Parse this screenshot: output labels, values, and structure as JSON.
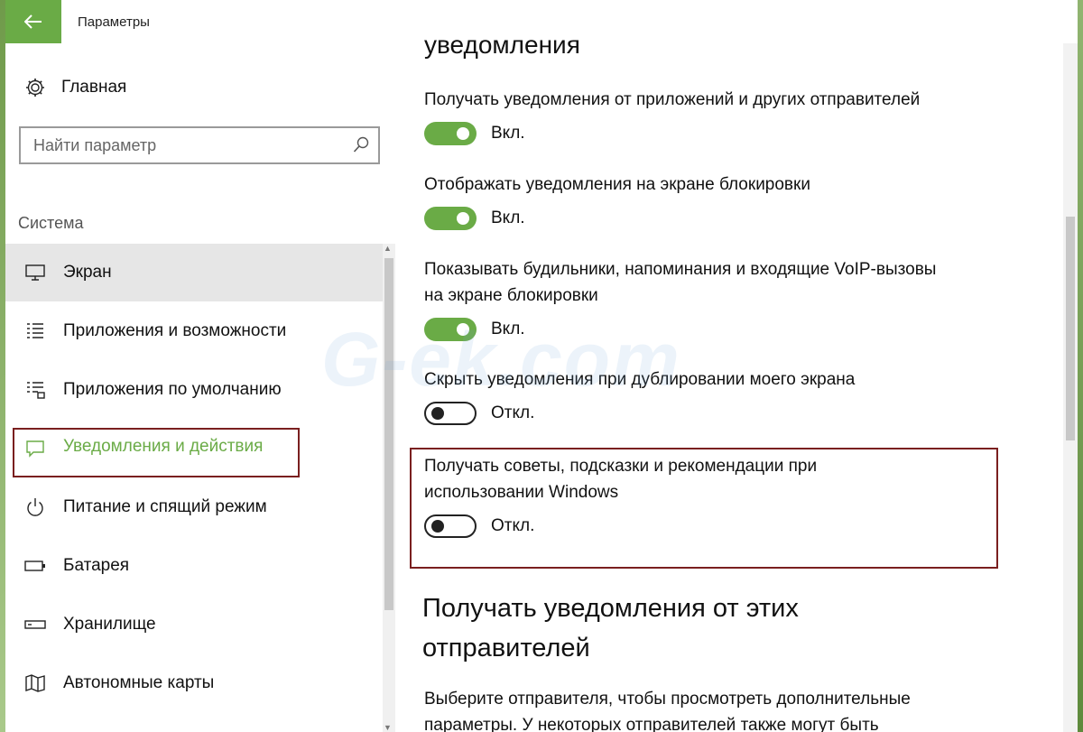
{
  "window": {
    "title": "Параметры",
    "accent": "#6aab46",
    "highlight": "#7a1f1f"
  },
  "sidebar": {
    "home_label": "Главная",
    "search_placeholder": "Найти параметр",
    "section_label": "Система",
    "items": [
      {
        "label": "Экран",
        "icon": "monitor-icon"
      },
      {
        "label": "Приложения и возможности",
        "icon": "apps-list-icon"
      },
      {
        "label": "Приложения по умолчанию",
        "icon": "default-apps-icon"
      },
      {
        "label": "Уведомления и действия",
        "icon": "notification-icon"
      },
      {
        "label": "Питание и спящий режим",
        "icon": "power-icon"
      },
      {
        "label": "Батарея",
        "icon": "battery-icon"
      },
      {
        "label": "Хранилище",
        "icon": "storage-icon"
      },
      {
        "label": "Автономные карты",
        "icon": "map-icon"
      }
    ]
  },
  "main": {
    "section_heading": "уведомления",
    "settings": [
      {
        "desc": "Получать уведомления от приложений и других отправителей",
        "state": "Вкл.",
        "on": true
      },
      {
        "desc": "Отображать уведомления на экране блокировки",
        "state": "Вкл.",
        "on": true
      },
      {
        "desc": "Показывать будильники, напоминания и входящие VoIP-вызовы на экране блокировки",
        "state": "Вкл.",
        "on": true
      },
      {
        "desc": "Скрыть уведомления при дублировании моего экрана",
        "state": "Откл.",
        "on": false
      },
      {
        "desc": "Получать советы, подсказки и рекомендации при использовании Windows",
        "state": "Откл.",
        "on": false
      }
    ],
    "senders_heading": "Получать уведомления от этих отправителей",
    "senders_text": "Выберите отправителя, чтобы просмотреть дополнительные параметры. У некоторых отправителей также могут быть"
  },
  "watermark": "G-ek.com"
}
